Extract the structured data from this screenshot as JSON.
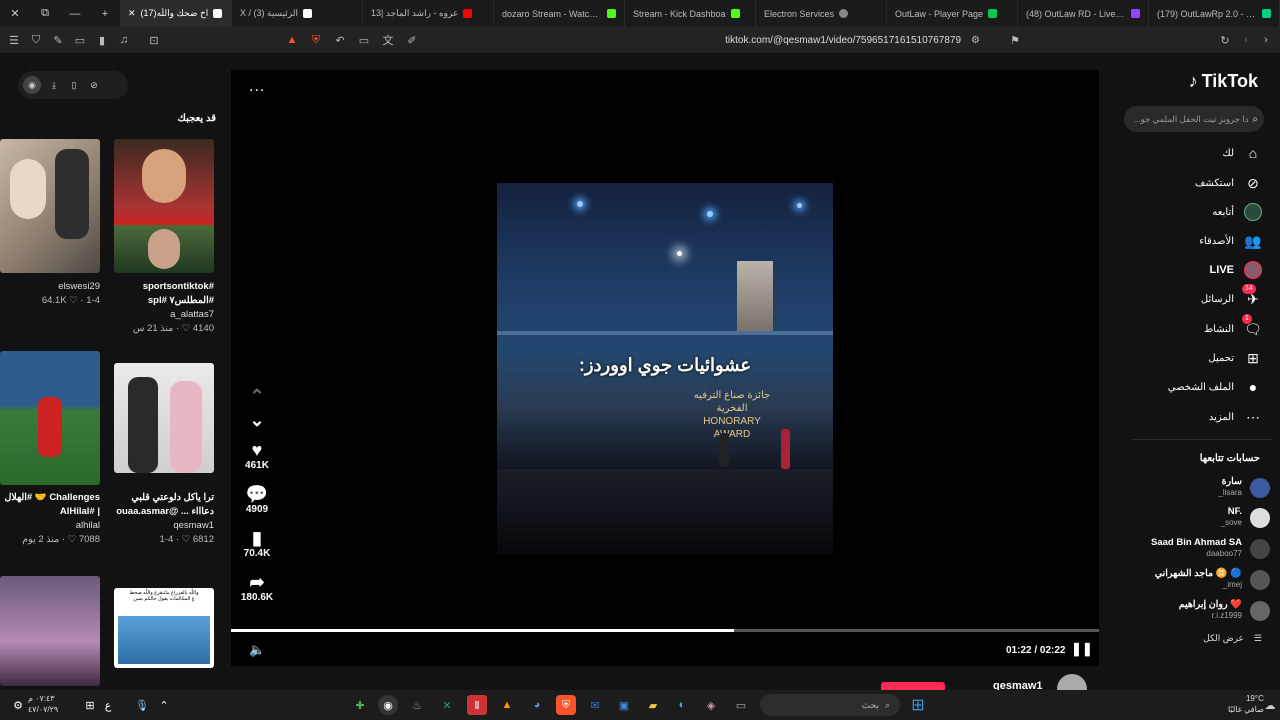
{
  "browser": {
    "tabs": [
      {
        "label": "(17)اخ ضحك واللّه",
        "active": true,
        "color": "#ffffff"
      },
      {
        "label": "X / (3) الرئيسية",
        "color": "#ffffff"
      },
      {
        "label": "13| عروه - راشد الماجد",
        "color": "#ff0000"
      },
      {
        "label": "dozaro Stream - Watch Li",
        "color": "#53fc18"
      },
      {
        "label": "Stream - Kick Dashboa",
        "color": "#53fc18"
      },
      {
        "label": "Electron Services",
        "color": "#888888"
      },
      {
        "label": "OutLaw - Player Page",
        "color": "#00c853"
      },
      {
        "label": "(48) OutLaw RD - Live Con",
        "color": "#9146ff"
      },
      {
        "label": "(179) OutLawRp 2.0 - Live",
        "color": "#00d084"
      }
    ],
    "new_tab": "+",
    "url": "tiktok.com/@qesmaw1/video/7596517161510767879"
  },
  "left": {
    "heading": "قد يعجبك",
    "videos": [
      {
        "caption": "",
        "user": "elswesi29",
        "stats": "64.1K ♡ · 1-4"
      },
      {
        "caption": "#sportsontiktok #المطلس٧ #spl",
        "user": "a_alattas7",
        "stats": "4140 ♡ · منذ 21 س"
      },
      {
        "caption": "Challenges 🤝 #الهلال | #AlHilal",
        "user": "alhilal",
        "stats": "7088 ♡ · منذ 2 يوم"
      },
      {
        "caption": "ترا ياكل دلوعتي قلبي دعاااء ... @ouaa.asmar",
        "user": "qesmaw1",
        "stats": "6812 ♡ · 1-4"
      }
    ],
    "thumb_text": "واللّه بالفزراع ماتنقرع واللّه ضحط\nع المكالمات يقول حالكم بسن"
  },
  "player": {
    "more": "...",
    "caption": "عشوائيات جوي اووردز:",
    "sign_ar": "جائزة صناع الترفيه الفخرية",
    "sign_en": "HONORARY AWARD",
    "likes": "461K",
    "comments": "4909",
    "saves": "70.4K",
    "shares": "180.6K",
    "time": "01:22 / 02:22",
    "progress": 0.58,
    "author": "qesmaw1"
  },
  "nav": {
    "logo": "TikTok",
    "search_placeholder": "دا جروبز تيت الحفل الملمي جو...",
    "items": [
      {
        "label": "لك",
        "icon": "home-icon"
      },
      {
        "label": "استكشف",
        "icon": "compass-icon"
      },
      {
        "label": "أتابعه",
        "icon": "following-icon"
      },
      {
        "label": "الأصدقاء",
        "icon": "friends-icon"
      },
      {
        "label": "LIVE",
        "icon": "live-icon"
      },
      {
        "label": "الرسائل",
        "icon": "messages-icon",
        "badge": "14"
      },
      {
        "label": "النشاط",
        "icon": "activity-icon",
        "badge": "1"
      },
      {
        "label": "تحميل",
        "icon": "upload-icon"
      },
      {
        "label": "الملف الشخصي",
        "icon": "profile-icon"
      },
      {
        "label": "المزيد",
        "icon": "more-icon"
      }
    ],
    "following_heading": "حسابات تتابعها",
    "following": [
      {
        "name": "سارة",
        "handle": "_lisara",
        "color": "#3b5aa0"
      },
      {
        "name": "NF.",
        "handle": "_sove",
        "color": "#ddd"
      },
      {
        "name": "Saad Bin Ahmad SA",
        "handle": "daaboo77",
        "color": "#444"
      },
      {
        "name": "ماجد الشهراني ♊ 🔵",
        "handle": "_imej",
        "color": "#555"
      },
      {
        "name": "روان إبراهيم ❤️",
        "handle": "r.i.z1999",
        "color": "#666"
      }
    ],
    "see_all": "عرض الكل"
  },
  "taskbar": {
    "time": "٠٧:٤٣ م",
    "date": "٤٧/٠٧/٢٩",
    "lang": "ع",
    "search": "بحث",
    "weather_temp": "19°C",
    "weather_desc": "صافي غالبًا"
  }
}
